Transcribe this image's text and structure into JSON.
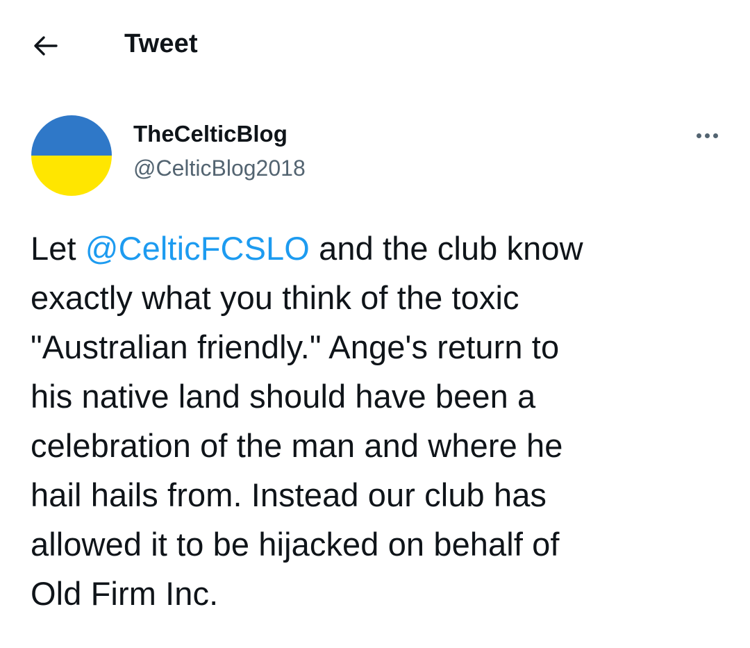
{
  "header": {
    "back_icon": "arrow-left-icon",
    "title": "Tweet"
  },
  "author": {
    "display_name": "TheCelticBlog",
    "handle": "@CelticBlog2018",
    "avatar_colors": {
      "top": "#2f78c8",
      "bottom": "#ffe600"
    },
    "more_icon": "more-horizontal-icon"
  },
  "tweet": {
    "mention": "@CelticFCSLO",
    "lines": [
      {
        "prefix": "Let ",
        "suffix": " and the club know"
      },
      "exactly what you think of the toxic",
      "\"Australian friendly.\" Ange's return to",
      "his native land should have been a",
      "celebration of the man and where he",
      "hail hails from. Instead our club has",
      "allowed it to be hijacked on behalf of",
      "Old Firm Inc."
    ]
  },
  "colors": {
    "text": "#0f1419",
    "secondary": "#536471",
    "link": "#1d9bf0"
  }
}
